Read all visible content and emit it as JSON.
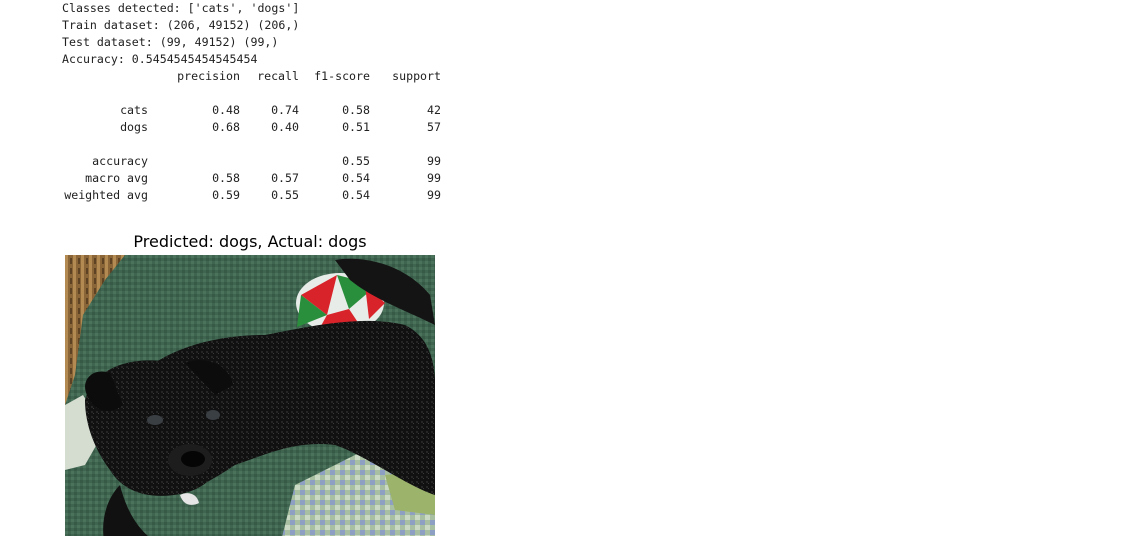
{
  "notebook_output": {
    "stdout_lines": [
      "Classes detected: ['cats', 'dogs']",
      "Train dataset: (206, 49152) (206,)",
      "Test dataset: (99, 49152) (99,)",
      "Accuracy: 0.5454545454545454"
    ],
    "classification_report": {
      "headers": {
        "precision": "precision",
        "recall": "recall",
        "f1": "f1-score",
        "support": "support"
      },
      "rows": [
        {
          "label": "cats",
          "precision": "0.48",
          "recall": "0.74",
          "f1": "0.58",
          "support": "42"
        },
        {
          "label": "dogs",
          "precision": "0.68",
          "recall": "0.40",
          "f1": "0.51",
          "support": "57"
        },
        {
          "label": "accuracy",
          "precision": "",
          "recall": "",
          "f1": "0.55",
          "support": "99"
        },
        {
          "label": "macro avg",
          "precision": "0.58",
          "recall": "0.57",
          "f1": "0.54",
          "support": "99"
        },
        {
          "label": "weighted avg",
          "precision": "0.59",
          "recall": "0.55",
          "f1": "0.54",
          "support": "99"
        }
      ]
    },
    "figure": {
      "title": "Predicted: dogs, Actual: dogs",
      "image_subject": "black-puppy-photo"
    }
  }
}
